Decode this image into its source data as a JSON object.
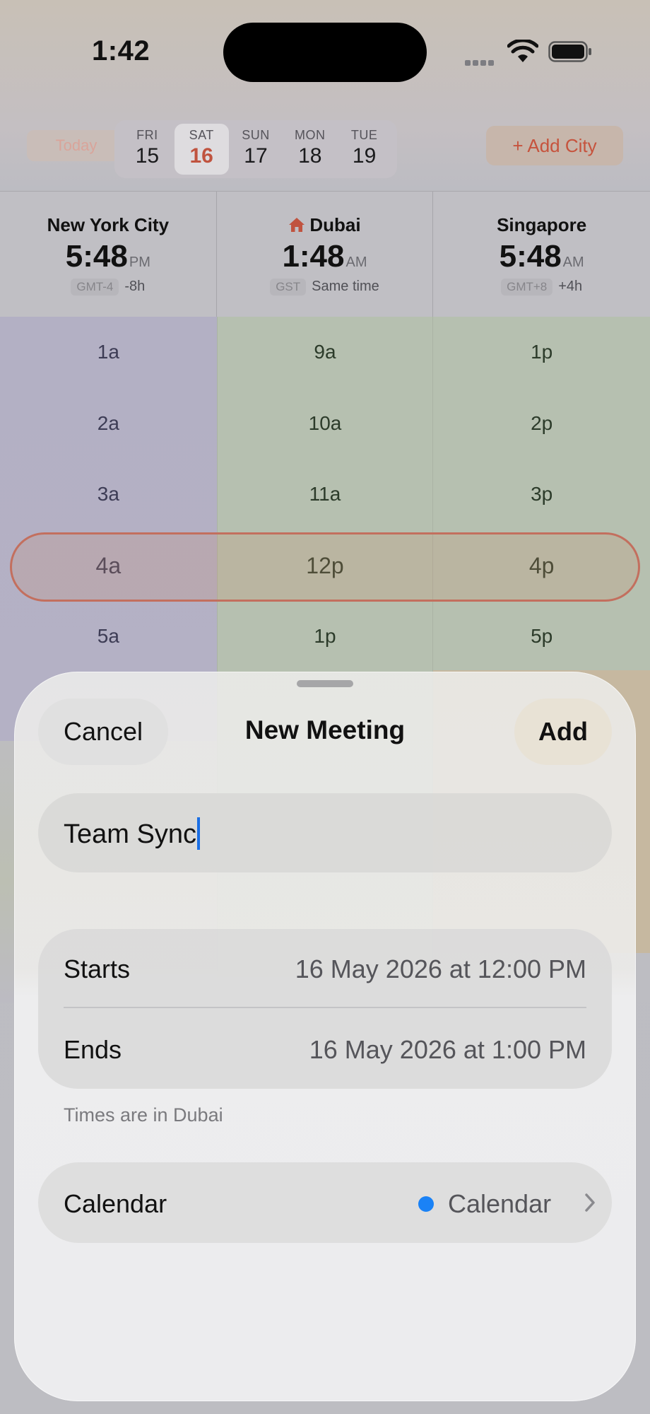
{
  "status_bar": {
    "time": "1:42"
  },
  "date_strip": {
    "today_label": "Today",
    "days": [
      {
        "dow": "FRI",
        "num": "15"
      },
      {
        "dow": "SAT",
        "num": "16",
        "selected": true
      },
      {
        "dow": "SUN",
        "num": "17"
      },
      {
        "dow": "MON",
        "num": "18"
      },
      {
        "dow": "TUE",
        "num": "19"
      }
    ],
    "add_city_label": "+ Add City"
  },
  "cities": [
    {
      "name": "New York City",
      "time": "5:48",
      "ampm": "PM",
      "tz": "GMT-4",
      "offset": "-8h",
      "home": false
    },
    {
      "name": "Dubai",
      "time": "1:48",
      "ampm": "AM",
      "tz": "GST",
      "offset": "Same time",
      "home": true
    },
    {
      "name": "Singapore",
      "time": "5:48",
      "ampm": "AM",
      "tz": "GMT+8",
      "offset": "+4h",
      "home": false
    }
  ],
  "hour_grid": [
    [
      "1a",
      "2a",
      "3a",
      "4a",
      "5a"
    ],
    [
      "9a",
      "10a",
      "11a",
      "12p",
      "1p"
    ],
    [
      "1p",
      "2p",
      "3p",
      "4p",
      "5p"
    ]
  ],
  "sheet": {
    "cancel_label": "Cancel",
    "title": "New Meeting",
    "add_label": "Add",
    "meeting_title_value": "Team Sync",
    "starts_label": "Starts",
    "starts_value": "16 May 2026 at 12:00 PM",
    "ends_label": "Ends",
    "ends_value": "16 May 2026 at 1:00 PM",
    "footnote": "Times are in Dubai",
    "calendar_label": "Calendar",
    "calendar_value": "Calendar",
    "calendar_color": "#1a82f6"
  },
  "colors": {
    "accent": "#c0533f",
    "now_band": "#c36f5e",
    "caret": "#1b6fe5"
  }
}
